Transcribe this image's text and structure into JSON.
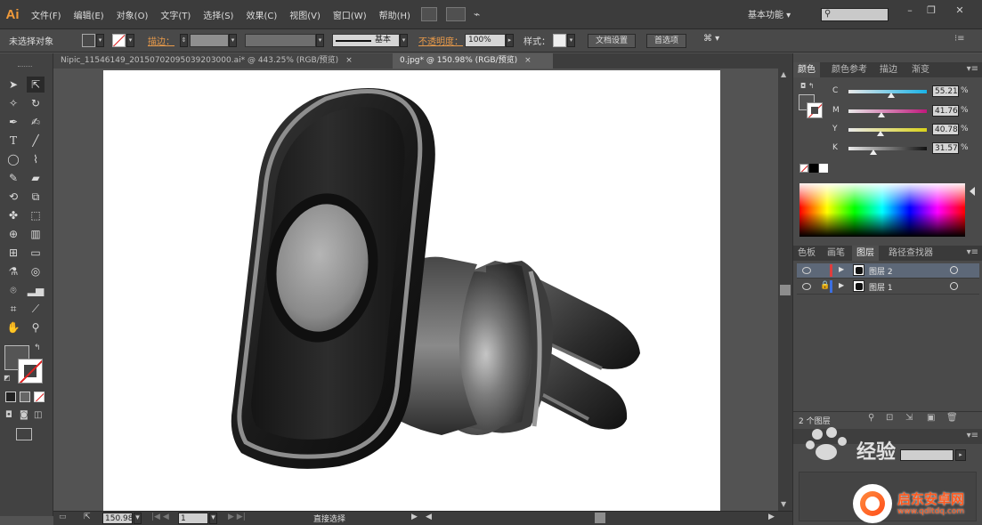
{
  "app": {
    "logo": "Ai"
  },
  "menu": [
    "文件(F)",
    "编辑(E)",
    "对象(O)",
    "文字(T)",
    "选择(S)",
    "效果(C)",
    "视图(V)",
    "窗口(W)",
    "帮助(H)"
  ],
  "workspace_label": "基本功能",
  "control_bar": {
    "selection_status": "未选择对象",
    "stroke_label": "描边：",
    "stroke_style": "基本",
    "opacity_label": "不透明度：",
    "opacity_value": "100%",
    "style_label": "样式：",
    "doc_setup_button": "文档设置",
    "preferences_button": "首选项"
  },
  "tabs": [
    {
      "label": "Nipic_11546149_20150702095039203000.ai* @ 443.25% (RGB/预览)",
      "active": false
    },
    {
      "label": "0.jpg* @ 150.98% (RGB/预览)",
      "active": true
    }
  ],
  "color_panel": {
    "tabs": [
      "颜色",
      "颜色参考",
      "描边",
      "渐变"
    ],
    "channels": [
      {
        "label": "C",
        "value": "55.21",
        "fraction": 0.55,
        "gradient": "#e9e9e9,#19b3e7"
      },
      {
        "label": "M",
        "value": "41.76",
        "fraction": 0.42,
        "gradient": "#e9e9e9,#c0187c"
      },
      {
        "label": "Y",
        "value": "40.78",
        "fraction": 0.41,
        "gradient": "#e9e9e9,#d9d21a"
      },
      {
        "label": "K",
        "value": "31.57",
        "fraction": 0.32,
        "gradient": "#e9e9e9,#111111"
      }
    ],
    "pct": "%"
  },
  "layers_panel": {
    "tabs": [
      "色板",
      "画笔",
      "图层",
      "路径查找器"
    ],
    "layers": [
      {
        "name": "图层 2",
        "color": "#e13c3c",
        "selected": true
      },
      {
        "name": "图层 1",
        "color": "#3c6fe1",
        "selected": false
      }
    ],
    "count": "2 个图层"
  },
  "status_bar": {
    "zoom": "150.98",
    "page": "1",
    "tool_status": "直接选择"
  },
  "watermark": {
    "jingyan": "经验",
    "site_name": "启东安卓网",
    "site_url": "www.qdltdq.com"
  },
  "icons": [
    "search-icon",
    "selection-tool-icon",
    "direct-selection-tool-icon",
    "pen-tool-icon",
    "type-tool-icon",
    "line-tool-icon",
    "ellipse-tool-icon",
    "brush-tool-icon",
    "pencil-tool-icon",
    "eraser-tool-icon",
    "rotate-tool-icon",
    "scale-tool-icon",
    "hand-tool-icon",
    "zoom-tool-icon",
    "eye-icon",
    "lock-icon",
    "panel-menu-icon"
  ]
}
